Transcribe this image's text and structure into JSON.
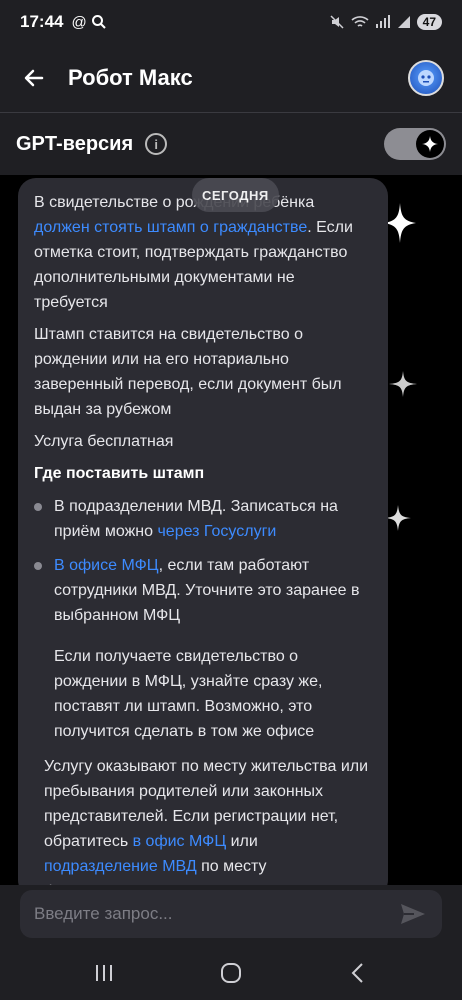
{
  "status": {
    "time": "17:44",
    "battery": "47"
  },
  "header": {
    "title": "Робот Макс"
  },
  "gpt": {
    "label": "GPT-версия"
  },
  "chat": {
    "date_chip": "СЕГОДНЯ",
    "p1_text": "В свидетельстве о рождении ребёнка ",
    "p1_link": "должен стоять штамп о гражданстве",
    "p1_text2": ". Если отметка стоит, подтверждать гражданство дополнительными документами не требуется",
    "p2": "Штамп ставится на свидетельство о рождении или на его нотариально заверенный перевод, если документ был выдан за рубежом",
    "p3": "Услуга бесплатная",
    "heading": "Где поставить штамп",
    "b1_text": "В подразделении МВД. Записаться на приём можно ",
    "b1_link": "через Госуслуги",
    "b2_link": "В офисе МФЦ",
    "b2_text": ", если там работают сотрудники МВД. Уточните это заранее в выбранном МФЦ",
    "p4": "Если получаете свидетельство о рождении в МФЦ, узнайте сразу же, поставят ли штамп. Возможно, это получится сделать в том же офисе",
    "p5_text": "Услугу оказывают по месту жительства или пребывания родителей или законных представителей. Если регистрации нет, обратитесь ",
    "p5_link1": "в офис МФЦ",
    "p5_mid": " или ",
    "p5_link2": "подразделение МВД",
    "p5_end": " по месту фактического проживания"
  },
  "input": {
    "placeholder": "Введите запрос..."
  },
  "colors": {
    "link": "#3d8bff",
    "bubble": "#2c2c33",
    "bar": "#1f1f23"
  }
}
